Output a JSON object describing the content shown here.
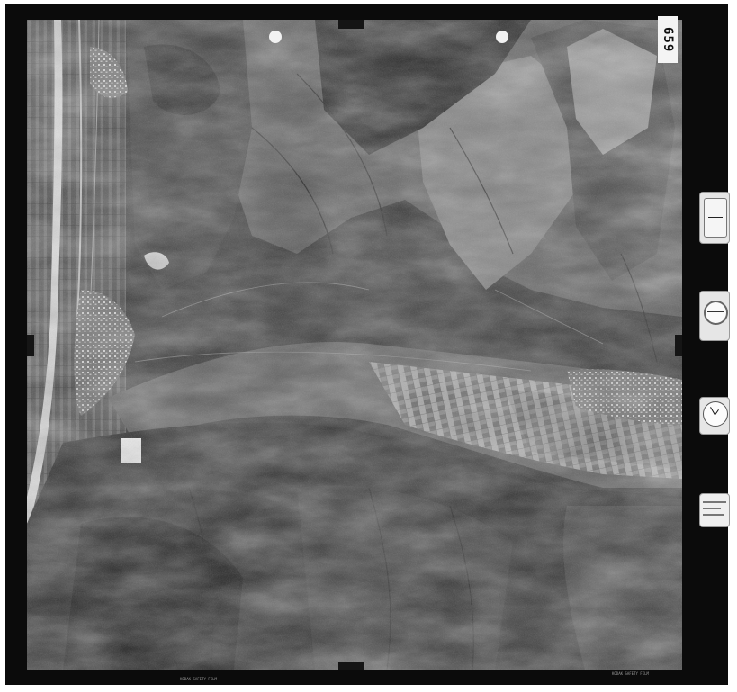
{
  "photo": {
    "frame_number": "659",
    "edge_text_left": "KODAK SAFETY FILM",
    "edge_text_right": "KODAK SAFETY FILM"
  },
  "instruments": {
    "altimeter": "altimeter-icon",
    "level": "level-bubble-icon",
    "level_top": "",
    "level_bottom": "",
    "clock": "clock-icon",
    "note": "handwritten-note-icon"
  },
  "colors": {
    "frame": "#0b0b0b",
    "paper": "#ffffff"
  }
}
